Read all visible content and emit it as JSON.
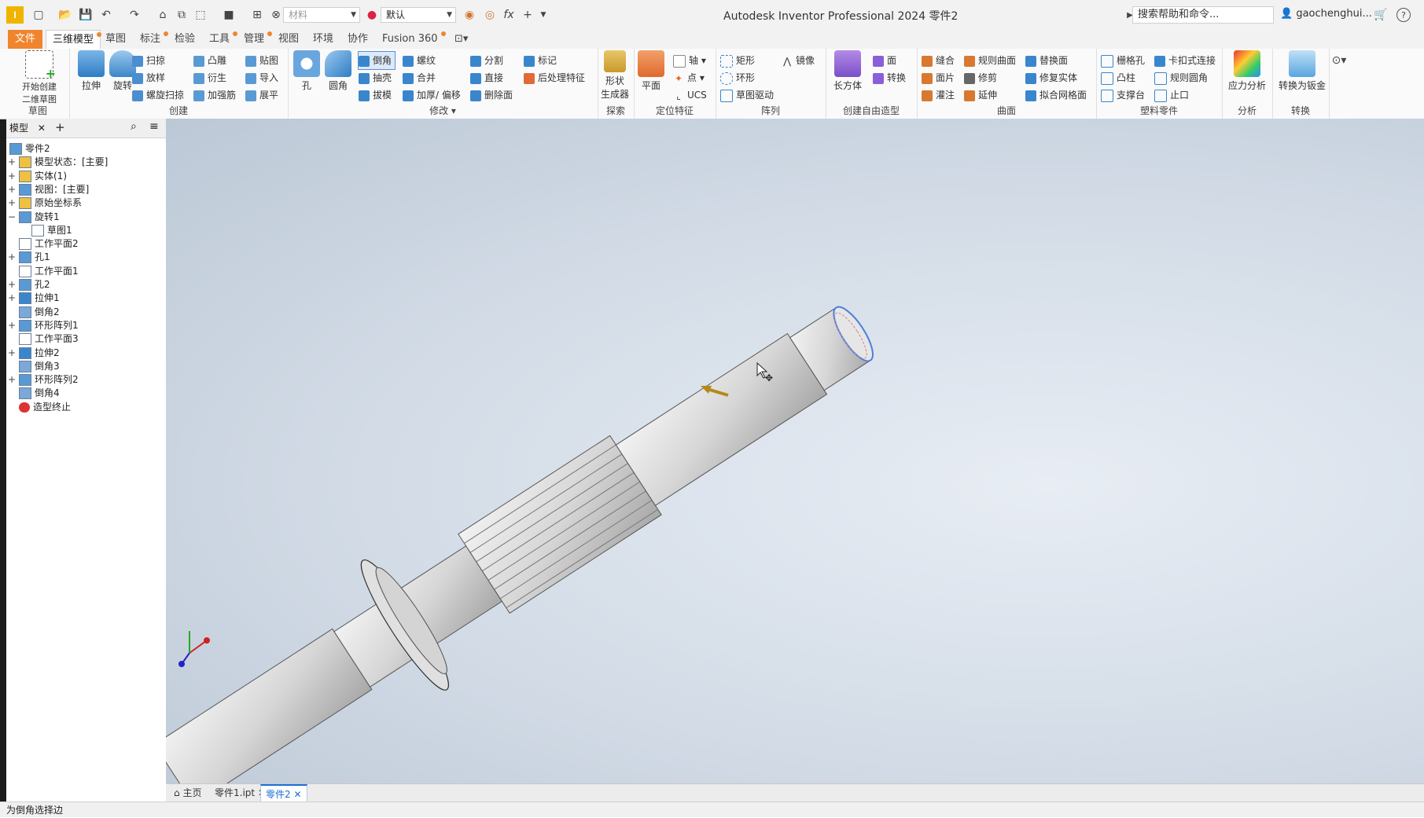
{
  "titlebar": {
    "app_title": "Autodesk Inventor Professional 2024   零件2",
    "material_placeholder": "材料",
    "appearance": "默认",
    "search_placeholder": "搜索帮助和命令...",
    "user": "gaochenghui...",
    "help": "?"
  },
  "tabs": [
    "文件",
    "三维模型",
    "草图",
    "标注",
    "检验",
    "工具",
    "管理",
    "视图",
    "环境",
    "协作",
    "Fusion 360"
  ],
  "ribbon": {
    "sketch_panel": {
      "start_sketch": "开始创建\n二维草图",
      "title": "草图"
    },
    "create_panel": {
      "extrude": "拉伸",
      "revolve": "旋转",
      "sweep": "扫掠",
      "loft": "放样",
      "coil": "螺旋扫掠",
      "emboss": "凸雕",
      "derive": "衍生",
      "rib": "加强筋",
      "decal": "贴图",
      "import": "导入",
      "unfold": "展平",
      "title": "创建"
    },
    "modify_panel": {
      "hole": "孔",
      "fillet": "圆角",
      "chamfer": "倒角",
      "shell": "抽壳",
      "draft": "拔模",
      "thread": "螺纹",
      "combine": "合并",
      "thicken": "加厚/ 偏移",
      "split": "分割",
      "direct": "直接",
      "delete_face": "删除面",
      "mark": "标记",
      "post_process": "后处理特征",
      "title": "修改"
    },
    "explore_panel": {
      "shape_generator": "形状\n生成器",
      "title": "探索"
    },
    "work_features_panel": {
      "plane": "平面",
      "axis": "轴",
      "point": "点",
      "ucs": "UCS",
      "title": "定位特征"
    },
    "pattern_panel": {
      "rect": "矩形",
      "circ": "环形",
      "sketch_driven": "草图驱动",
      "mirror": "镜像",
      "title": "阵列"
    },
    "freeform_panel": {
      "box": "长方体",
      "face": "面",
      "convert": "转换",
      "title": "创建自由造型"
    },
    "surface_panel": {
      "stitch": "缝合",
      "patch": "面片",
      "sculpt": "灌注",
      "ruled": "规则曲面",
      "trim": "修剪",
      "extend": "延伸",
      "replace": "替换面",
      "repair": "修复实体",
      "fit_mesh": "拟合网格面",
      "title": "曲面"
    },
    "plastic_panel": {
      "grill": "栅格孔",
      "boss": "凸柱",
      "rest": "支撑台",
      "snap": "卡扣式连接",
      "rule_fillet": "规则圆角",
      "lip": "止口",
      "title": "塑料零件"
    },
    "analysis_panel": {
      "stress": "应力分析",
      "title": "分析"
    },
    "convert_panel": {
      "sheet_metal": "转换为钣金",
      "title": "转换"
    }
  },
  "browser": {
    "tab_label": "模型",
    "tree": [
      {
        "label": "零件2",
        "level": 0
      },
      {
        "label": "模型状态：[主要]",
        "level": 1,
        "expand": "+"
      },
      {
        "label": "实体(1)",
        "level": 1,
        "expand": "+"
      },
      {
        "label": "视图：[主要]",
        "level": 1,
        "expand": "+"
      },
      {
        "label": "原始坐标系",
        "level": 1,
        "expand": "+"
      },
      {
        "label": "旋转1",
        "level": 1,
        "expand": "−"
      },
      {
        "label": "草图1",
        "level": 2
      },
      {
        "label": "工作平面2",
        "level": 1
      },
      {
        "label": "孔1",
        "level": 1,
        "expand": "+"
      },
      {
        "label": "工作平面1",
        "level": 1
      },
      {
        "label": "孔2",
        "level": 1,
        "expand": "+"
      },
      {
        "label": "拉伸1",
        "level": 1,
        "expand": "+"
      },
      {
        "label": "倒角2",
        "level": 1
      },
      {
        "label": "环形阵列1",
        "level": 1,
        "expand": "+"
      },
      {
        "label": "工作平面3",
        "level": 1
      },
      {
        "label": "拉伸2",
        "level": 1,
        "expand": "+"
      },
      {
        "label": "倒角3",
        "level": 1
      },
      {
        "label": "环形阵列2",
        "level": 1,
        "expand": "+"
      },
      {
        "label": "倒角4",
        "level": 1
      },
      {
        "label": "造型终止",
        "level": 1
      }
    ]
  },
  "doc_tabs": {
    "home": "主页",
    "part1": "零件1.ipt",
    "part2": "零件2"
  },
  "status": "为倒角选择边",
  "colors": {
    "file_tab": "#f0852d",
    "accent": "#1a6fd6"
  }
}
